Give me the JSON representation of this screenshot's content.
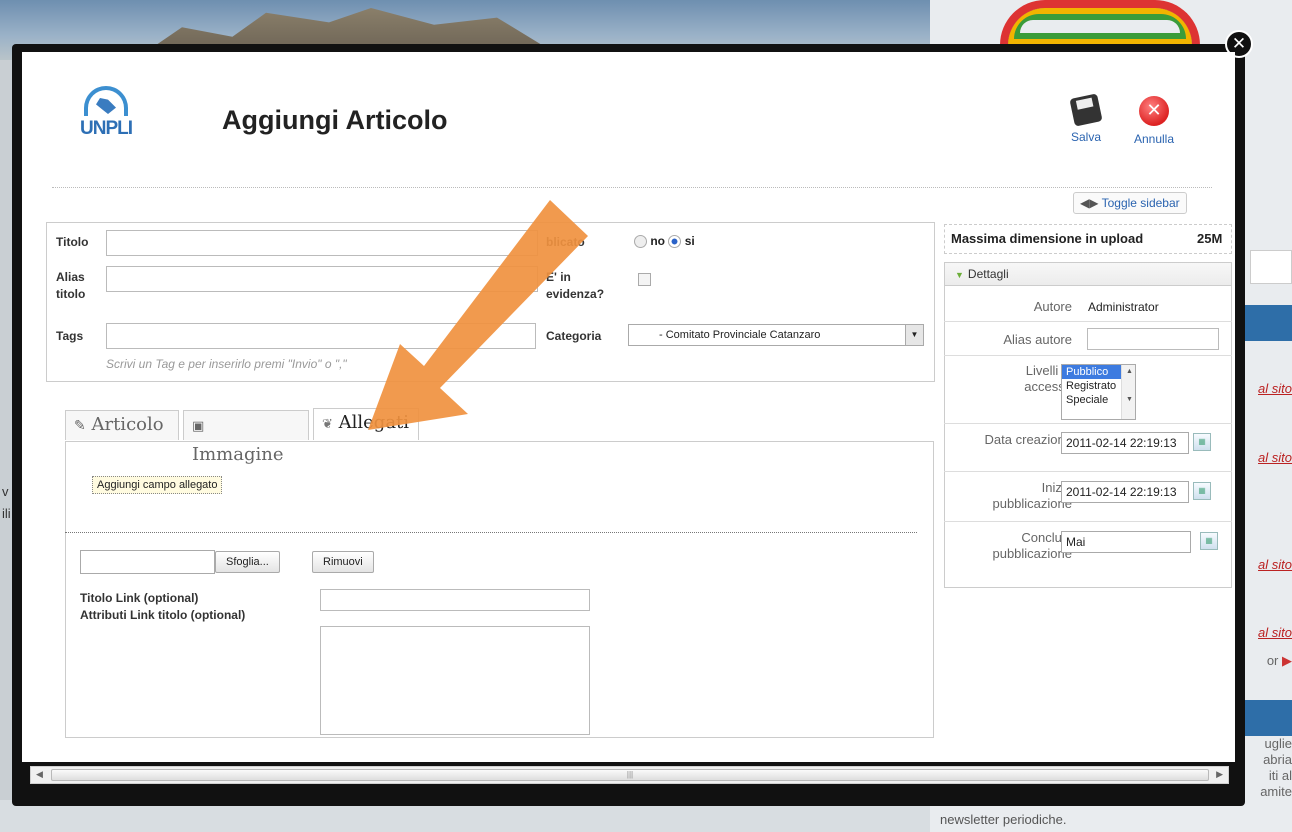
{
  "background": {
    "sidebar_links": [
      "al sito",
      "al sito",
      "al sito",
      "al sito"
    ],
    "side_text_lines": [
      "uglie",
      "abria",
      "iti al",
      "amite"
    ],
    "side_small": "or",
    "newsletter": "newsletter periodiche.",
    "left_fragments": [
      "v",
      "ili"
    ]
  },
  "header": {
    "logo_text": "UNPLI",
    "title": "Aggiungi Articolo",
    "save_label": "Salva",
    "cancel_label": "Annulla",
    "toggle_sidebar": "Toggle sidebar"
  },
  "form": {
    "titolo_label": "Titolo",
    "alias_label": "Alias titolo",
    "tags_label": "Tags",
    "tags_hint": "Scrivi un Tag e per inserirlo premi \"Invio\" o \",\"",
    "pubblicato_label": "blicato",
    "pubblicato_no": "no",
    "pubblicato_si": "si",
    "evidenza_label": "E' in evidenza?",
    "categoria_label": "Categoria",
    "categoria_value": "- Comitato Provinciale Catanzaro"
  },
  "tabs": [
    {
      "label": "Articolo",
      "icon": "edit-icon"
    },
    {
      "label": "Immagine",
      "icon": "image-icon"
    },
    {
      "label": "Allegati",
      "icon": "paperclip-icon"
    }
  ],
  "attachments": {
    "add_field_button": "Aggiungi campo allegato",
    "browse_button": "Sfoglia...",
    "remove_button": "Rimuovi",
    "titolo_link_label": "Titolo Link (optional)",
    "attributi_link_label": "Attributi Link titolo (optional)"
  },
  "sidebar": {
    "upload_label": "Massima dimensione in upload",
    "upload_value": "25M",
    "details_header": "Dettagli",
    "autore_label": "Autore",
    "autore_value": "Administrator",
    "alias_autore_label": "Alias autore",
    "livelli_label": "Livelli di accesso",
    "access_options": [
      "Pubblico",
      "Registrato",
      "Speciale"
    ],
    "access_selected": "Pubblico",
    "data_creazione_label": "Data creazione",
    "data_creazione_value": "2011-02-14 22:19:13",
    "inizia_label": "Inizia pubblicazione",
    "inizia_value": "2011-02-14 22:19:13",
    "concludi_label": "Concludi pubblicazione",
    "concludi_value": "Mai"
  },
  "colors": {
    "arrow": "#f0913f",
    "link": "#2b64b0",
    "selected": "#3d7be0"
  }
}
